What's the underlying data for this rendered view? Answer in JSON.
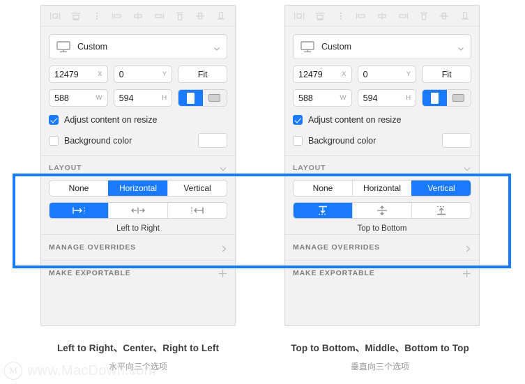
{
  "align_toolbar": {
    "icons": [
      {
        "name": "align-left-icon",
        "title": "Align left"
      },
      {
        "name": "align-horizontal-center-icon",
        "title": "Align horizontal center"
      },
      {
        "name": "more-options-icon",
        "title": "More options"
      },
      {
        "name": "distribute-left-icon",
        "title": "Distribute left"
      },
      {
        "name": "distribute-center-icon",
        "title": "Distribute center"
      },
      {
        "name": "distribute-right-icon",
        "title": "Distribute right"
      },
      {
        "name": "align-top-icon",
        "title": "Align top"
      },
      {
        "name": "align-vertical-center-icon",
        "title": "Align vertical center"
      },
      {
        "name": "align-bottom-icon",
        "title": "Align bottom"
      }
    ]
  },
  "panels": [
    {
      "id": "left",
      "device": {
        "label": "Custom",
        "icon": "screen-icon"
      },
      "position": {
        "x_value": "12479",
        "x_unit": "X",
        "y_value": "0",
        "y_unit": "Y",
        "fit_label": "Fit"
      },
      "size": {
        "w_value": "588",
        "w_unit": "W",
        "h_value": "594",
        "h_unit": "H"
      },
      "orientation": {
        "portrait_selected": true,
        "landscape_selected": false
      },
      "adjust_content": {
        "label": "Adjust content on resize",
        "checked": true
      },
      "background_color": {
        "label": "Background color",
        "checked": false,
        "swatch": "#ffffff"
      },
      "layout": {
        "section_title": "LAYOUT",
        "modes": [
          "None",
          "Horizontal",
          "Vertical"
        ],
        "active_mode": "Horizontal",
        "directions": [
          "left-to-right-icon",
          "center-horizontal-icon",
          "right-to-left-icon"
        ],
        "active_direction_index": 0,
        "direction_caption": "Left to Right"
      },
      "manage_overrides": {
        "label": "MANAGE OVERRIDES",
        "icon": "chevron-right-icon"
      },
      "make_exportable": {
        "label": "MAKE EXPORTABLE",
        "icon": "plus-icon"
      }
    },
    {
      "id": "right",
      "device": {
        "label": "Custom",
        "icon": "screen-icon"
      },
      "position": {
        "x_value": "12479",
        "x_unit": "X",
        "y_value": "0",
        "y_unit": "Y",
        "fit_label": "Fit"
      },
      "size": {
        "w_value": "588",
        "w_unit": "W",
        "h_value": "594",
        "h_unit": "H"
      },
      "orientation": {
        "portrait_selected": true,
        "landscape_selected": false
      },
      "adjust_content": {
        "label": "Adjust content on resize",
        "checked": true
      },
      "background_color": {
        "label": "Background color",
        "checked": false,
        "swatch": "#ffffff"
      },
      "layout": {
        "section_title": "LAYOUT",
        "modes": [
          "None",
          "Horizontal",
          "Vertical"
        ],
        "active_mode": "Vertical",
        "directions": [
          "top-to-bottom-icon",
          "center-vertical-icon",
          "bottom-to-top-icon"
        ],
        "active_direction_index": 0,
        "direction_caption": "Top to Bottom"
      },
      "manage_overrides": {
        "label": "MANAGE OVERRIDES",
        "icon": "chevron-right-icon"
      },
      "make_exportable": {
        "label": "MAKE EXPORTABLE",
        "icon": "plus-icon"
      }
    }
  ],
  "captions": [
    {
      "en": "Left to Right、Center、Right to Left",
      "zh": "水平向三个选项"
    },
    {
      "en": "Top to Bottom、Middle、Bottom to Top",
      "zh": "垂直向三个选项"
    }
  ],
  "watermark": {
    "logo": "M",
    "text": "www.MacDown.com"
  },
  "colors": {
    "accent": "#1a7aff",
    "panel_bg": "#f2f2f2",
    "field_bg": "#ffffff",
    "text": "#1d1d1d",
    "muted": "#8a8a8a"
  }
}
